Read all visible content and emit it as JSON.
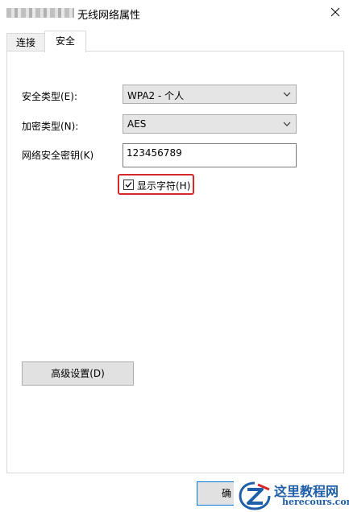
{
  "window": {
    "title": "无线网络属性",
    "close_label": "×"
  },
  "tabs": [
    {
      "label": "连接",
      "selected": false
    },
    {
      "label": "安全",
      "selected": true
    }
  ],
  "security": {
    "security_type_label": "安全类型(E):",
    "security_type_value": "WPA2 - 个人",
    "encryption_type_label": "加密类型(N):",
    "encryption_type_value": "AES",
    "network_key_label": "网络安全密钥(K)",
    "network_key_value": "123456789",
    "show_characters_label": "显示字符(H)",
    "show_characters_checked": true
  },
  "buttons": {
    "advanced_label": "高级设置(D)",
    "ok_label": "确"
  },
  "watermark": {
    "title": "这里教程网",
    "url": "herecours.com"
  },
  "colors": {
    "highlight_border": "#d6282a",
    "watermark_blue": "#1f5fa8",
    "focus_blue": "#0078d7"
  }
}
